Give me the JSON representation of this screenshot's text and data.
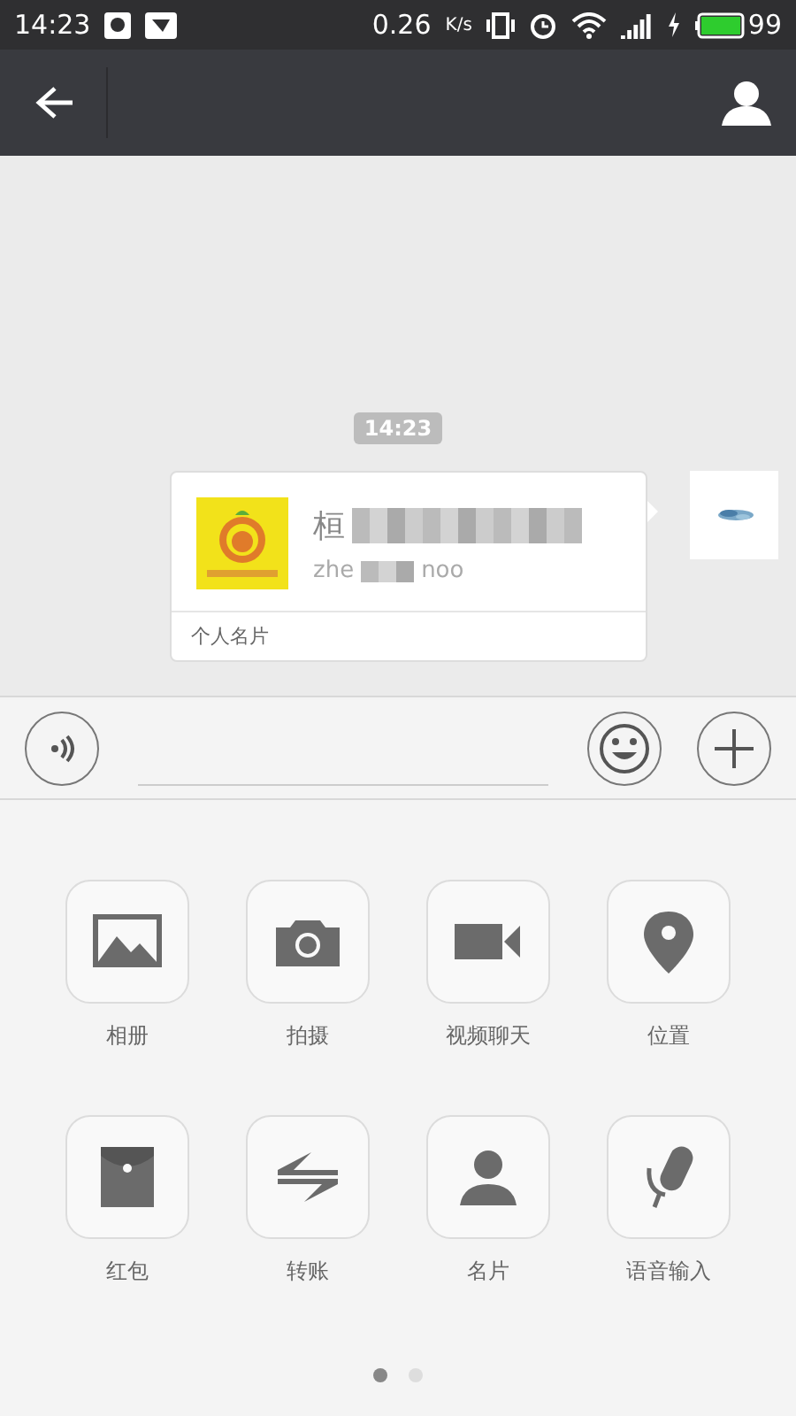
{
  "status_bar": {
    "time": "14:23",
    "speed": "0.26",
    "speed_unit": "K/s",
    "battery": "99"
  },
  "chat": {
    "timestamp": "14:23",
    "card": {
      "name": "桓",
      "username_start": "zhe",
      "username_end": "noo",
      "footer": "个人名片"
    }
  },
  "actions": [
    {
      "label": "相册",
      "kind": "album"
    },
    {
      "label": "拍摄",
      "kind": "camera"
    },
    {
      "label": "视频聊天",
      "kind": "video"
    },
    {
      "label": "位置",
      "kind": "location"
    },
    {
      "label": "红包",
      "kind": "envelope"
    },
    {
      "label": "转账",
      "kind": "transfer"
    },
    {
      "label": "名片",
      "kind": "contact"
    },
    {
      "label": "语音输入",
      "kind": "voice"
    }
  ],
  "pages": [
    {
      "selected": true
    },
    {
      "selected": false
    }
  ]
}
